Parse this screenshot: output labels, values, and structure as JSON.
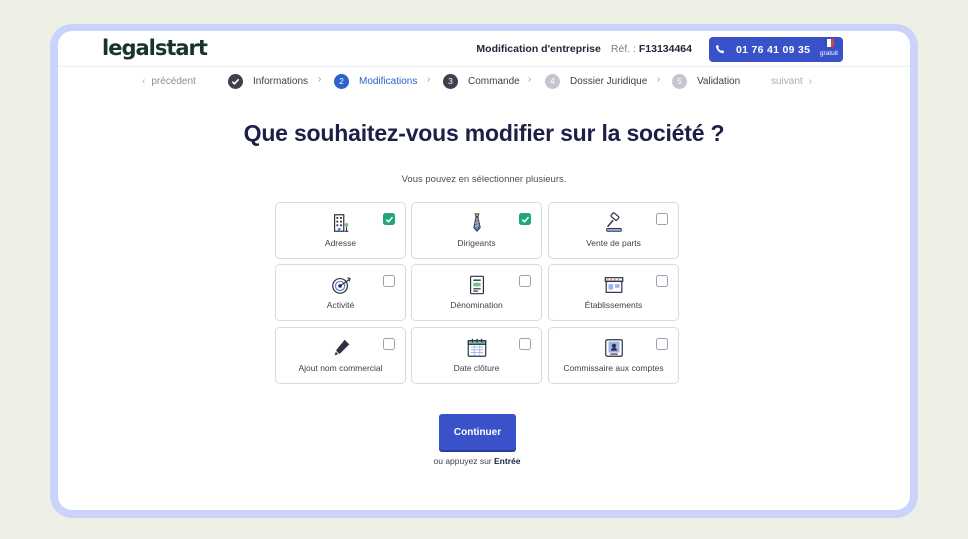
{
  "header": {
    "logo": "legalstart",
    "context": "Modification d'entreprise",
    "ref_label": "Réf. :",
    "ref_value": "F13134464",
    "phone": "01 76 41 09 35",
    "phone_note": "gratuit",
    "flag_colors": [
      "#2f4fb6",
      "#ffffff",
      "#e23d3d"
    ]
  },
  "stepper": {
    "prev_label": "précédent",
    "next_label": "suivant",
    "steps": [
      {
        "number": "",
        "label": "Informations",
        "state": "done"
      },
      {
        "number": "2",
        "label": "Modifications",
        "state": "active"
      },
      {
        "number": "3",
        "label": "Commande",
        "state": "upcoming"
      },
      {
        "number": "4",
        "label": "Dossier Juridique",
        "state": "disabled"
      },
      {
        "number": "5",
        "label": "Validation",
        "state": "disabled"
      }
    ]
  },
  "main": {
    "title": "Que souhaitez-vous modifier sur la société ?",
    "subtitle": "Vous pouvez en sélectionner plusieurs.",
    "options": [
      {
        "label": "Adresse",
        "icon": "building-icon",
        "selected": true
      },
      {
        "label": "Dirigeants",
        "icon": "tie-icon",
        "selected": true
      },
      {
        "label": "Vente de parts",
        "icon": "gavel-icon",
        "selected": false
      },
      {
        "label": "Activité",
        "icon": "target-icon",
        "selected": false
      },
      {
        "label": "Dénomination",
        "icon": "document-icon",
        "selected": false
      },
      {
        "label": "Établissements",
        "icon": "shop-icon",
        "selected": false
      },
      {
        "label": "Ajout nom commercial",
        "icon": "pen-icon",
        "selected": false
      },
      {
        "label": "Date clôture",
        "icon": "calendar-icon",
        "selected": false
      },
      {
        "label": "Commissaire aux comptes",
        "icon": "id-card-icon",
        "selected": false
      }
    ],
    "continue_label": "Continuer",
    "hint_prefix": "ou appuyez sur",
    "hint_key": "Entrée"
  },
  "colors": {
    "brand": "#3a52c9",
    "selected_bg": "#e5f5ee",
    "check": "#21a67a",
    "title": "#1c2046"
  }
}
